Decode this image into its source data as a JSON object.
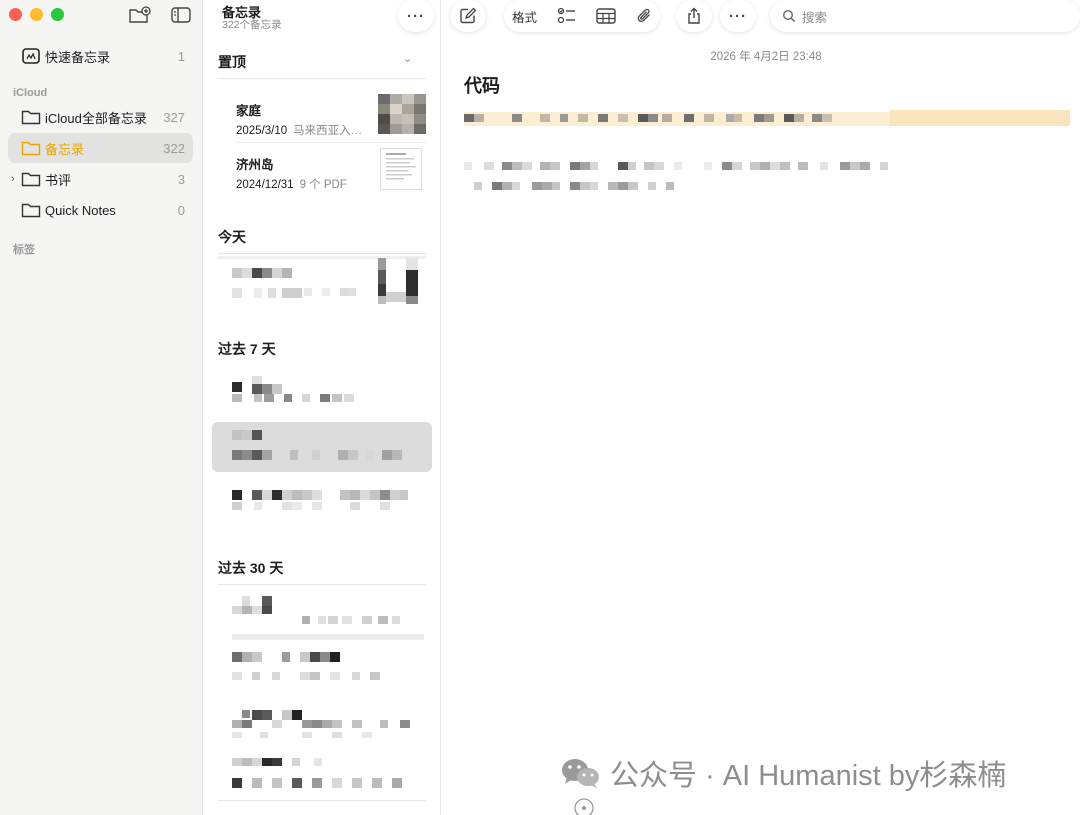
{
  "sidebar": {
    "items": [
      {
        "label": "快速备忘录",
        "count": "1"
      },
      {
        "label": "iCloud全部备忘录",
        "count": "327"
      },
      {
        "label": "备忘录",
        "count": "322"
      },
      {
        "label": "书评",
        "count": "3"
      },
      {
        "label": "Quick Notes",
        "count": "0"
      }
    ],
    "section_icloud": "iCloud",
    "section_tags": "标签",
    "accent": "#e6a500"
  },
  "list": {
    "title": "备忘录",
    "subtitle": "322个备忘录",
    "groups": {
      "pinned": "置顶",
      "today": "今天",
      "past7": "过去 7 天",
      "past30": "过去 30 天"
    },
    "pinned_notes": [
      {
        "title": "家庭",
        "date": "2025/3/10",
        "snippet": "马来西亚入…"
      },
      {
        "title": "济州岛",
        "date": "2024/12/31",
        "snippet": "9 个 PDF"
      }
    ]
  },
  "toolbar": {
    "format_label": "格式",
    "search_placeholder": "搜索"
  },
  "note": {
    "date": "2026 年 4月2日 23:48",
    "title": "代码"
  },
  "watermark": {
    "text": "公众号 · AI Humanist by杉森楠"
  }
}
